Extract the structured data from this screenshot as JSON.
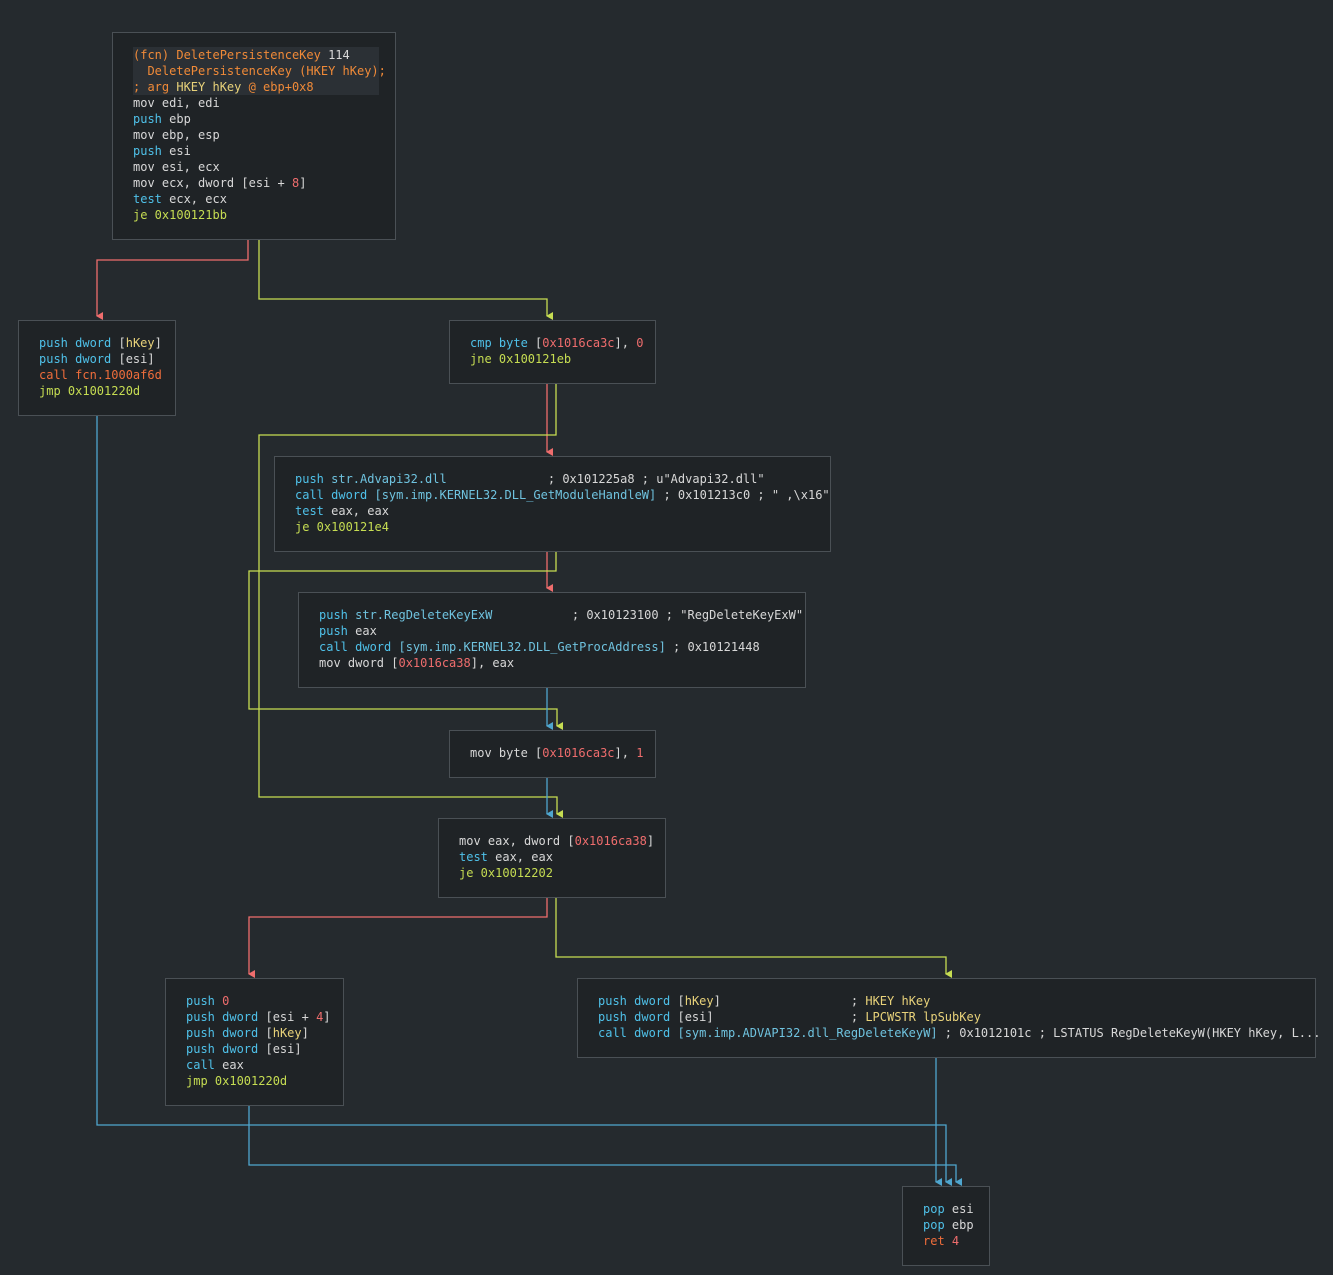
{
  "colors": {
    "background": "#252a2e",
    "node_bg": "#1f2326",
    "node_border": "#4a5055",
    "edge_true": "#c6dd52",
    "edge_false": "#ef6d6d",
    "edge_uncond": "#4fa6cf"
  },
  "nodes": {
    "n1": {
      "header": [
        [
          {
            "t": "(fcn) DeletePersistenceKey ",
            "c": "c-orange"
          },
          {
            "t": "114",
            "c": "c-plain"
          }
        ],
        [
          {
            "t": "  DeletePersistenceKey ",
            "c": "c-orange"
          },
          {
            "t": "(HKEY hKey);",
            "c": "c-orange"
          }
        ],
        [
          {
            "t": "; arg ",
            "c": "c-orange"
          },
          {
            "t": "HKEY hKey ",
            "c": "c-yellow"
          },
          {
            "t": "@ ebp+0x8",
            "c": "c-orange"
          }
        ]
      ],
      "lines": [
        [
          {
            "t": "mov ",
            "c": "c-plain"
          },
          {
            "t": "edi, edi",
            "c": "c-plain"
          }
        ],
        [
          {
            "t": "push ",
            "c": "op-blue"
          },
          {
            "t": "ebp",
            "c": "c-plain"
          }
        ],
        [
          {
            "t": "mov ",
            "c": "c-plain"
          },
          {
            "t": "ebp, esp",
            "c": "c-plain"
          }
        ],
        [
          {
            "t": "push ",
            "c": "op-blue"
          },
          {
            "t": "esi",
            "c": "c-plain"
          }
        ],
        [
          {
            "t": "mov ",
            "c": "c-plain"
          },
          {
            "t": "esi, ecx",
            "c": "c-plain"
          }
        ],
        [
          {
            "t": "mov ",
            "c": "c-plain"
          },
          {
            "t": "ecx, dword [esi + ",
            "c": "c-plain"
          },
          {
            "t": "8",
            "c": "c-red"
          },
          {
            "t": "]",
            "c": "c-plain"
          }
        ],
        [
          {
            "t": "test ",
            "c": "op-blue"
          },
          {
            "t": "ecx, ecx",
            "c": "c-plain"
          }
        ],
        [
          {
            "t": "je 0x100121bb",
            "c": "op-green"
          }
        ]
      ]
    },
    "n2": {
      "lines": [
        [
          {
            "t": "push dword ",
            "c": "op-blue"
          },
          {
            "t": "[",
            "c": "c-plain"
          },
          {
            "t": "hKey",
            "c": "c-yellow"
          },
          {
            "t": "]",
            "c": "c-plain"
          }
        ],
        [
          {
            "t": "push dword ",
            "c": "op-blue"
          },
          {
            "t": "[esi]",
            "c": "c-plain"
          }
        ],
        [
          {
            "t": "call fcn.1000af6d",
            "c": "op-red"
          }
        ],
        [
          {
            "t": "jmp 0x1001220d",
            "c": "op-green"
          }
        ]
      ]
    },
    "n3": {
      "lines": [
        [
          {
            "t": "cmp byte ",
            "c": "op-blue"
          },
          {
            "t": "[",
            "c": "c-plain"
          },
          {
            "t": "0x1016ca3c",
            "c": "c-red"
          },
          {
            "t": "], ",
            "c": "c-plain"
          },
          {
            "t": "0",
            "c": "c-red"
          }
        ],
        [
          {
            "t": "jne 0x100121eb",
            "c": "op-green"
          }
        ]
      ]
    },
    "n4": {
      "lines": [
        [
          {
            "t": "push ",
            "c": "op-blue"
          },
          {
            "t": "str.Advapi32.dll",
            "c": "c-cyan"
          },
          {
            "t": "              ; 0x101225a8 ; u\"Advapi32.dll\"",
            "c": "c-comment"
          }
        ],
        [
          {
            "t": "call dword ",
            "c": "op-blue"
          },
          {
            "t": "[sym.imp.KERNEL32.DLL_GetModuleHandleW]",
            "c": "c-cyan"
          },
          {
            "t": " ; 0x101213c0 ; \" ,\\x16\"",
            "c": "c-comment"
          }
        ],
        [
          {
            "t": "test ",
            "c": "op-blue"
          },
          {
            "t": "eax, eax",
            "c": "c-plain"
          }
        ],
        [
          {
            "t": "je 0x100121e4",
            "c": "op-green"
          }
        ]
      ]
    },
    "n5": {
      "lines": [
        [
          {
            "t": "push ",
            "c": "op-blue"
          },
          {
            "t": "str.RegDeleteKeyExW",
            "c": "c-cyan"
          },
          {
            "t": "           ; 0x10123100 ; \"RegDeleteKeyExW\"",
            "c": "c-comment"
          }
        ],
        [
          {
            "t": "push ",
            "c": "op-blue"
          },
          {
            "t": "eax",
            "c": "c-plain"
          }
        ],
        [
          {
            "t": "call dword ",
            "c": "op-blue"
          },
          {
            "t": "[sym.imp.KERNEL32.DLL_GetProcAddress]",
            "c": "c-cyan"
          },
          {
            "t": " ; 0x10121448",
            "c": "c-comment"
          }
        ],
        [
          {
            "t": "mov ",
            "c": "c-plain"
          },
          {
            "t": "dword [",
            "c": "c-plain"
          },
          {
            "t": "0x1016ca38",
            "c": "c-red"
          },
          {
            "t": "], eax",
            "c": "c-plain"
          }
        ]
      ]
    },
    "n6": {
      "lines": [
        [
          {
            "t": "mov ",
            "c": "c-plain"
          },
          {
            "t": "byte [",
            "c": "c-plain"
          },
          {
            "t": "0x1016ca3c",
            "c": "c-red"
          },
          {
            "t": "], ",
            "c": "c-plain"
          },
          {
            "t": "1",
            "c": "c-red"
          }
        ]
      ]
    },
    "n7": {
      "lines": [
        [
          {
            "t": "mov ",
            "c": "c-plain"
          },
          {
            "t": "eax, dword [",
            "c": "c-plain"
          },
          {
            "t": "0x1016ca38",
            "c": "c-red"
          },
          {
            "t": "]",
            "c": "c-plain"
          }
        ],
        [
          {
            "t": "test ",
            "c": "op-blue"
          },
          {
            "t": "eax, eax",
            "c": "c-plain"
          }
        ],
        [
          {
            "t": "je 0x10012202",
            "c": "op-green"
          }
        ]
      ]
    },
    "n8": {
      "lines": [
        [
          {
            "t": "push ",
            "c": "op-blue"
          },
          {
            "t": "0",
            "c": "c-red"
          }
        ],
        [
          {
            "t": "push dword ",
            "c": "op-blue"
          },
          {
            "t": "[esi + ",
            "c": "c-plain"
          },
          {
            "t": "4",
            "c": "c-red"
          },
          {
            "t": "]",
            "c": "c-plain"
          }
        ],
        [
          {
            "t": "push dword ",
            "c": "op-blue"
          },
          {
            "t": "[",
            "c": "c-plain"
          },
          {
            "t": "hKey",
            "c": "c-yellow"
          },
          {
            "t": "]",
            "c": "c-plain"
          }
        ],
        [
          {
            "t": "push dword ",
            "c": "op-blue"
          },
          {
            "t": "[esi]",
            "c": "c-plain"
          }
        ],
        [
          {
            "t": "call ",
            "c": "op-blue"
          },
          {
            "t": "eax",
            "c": "c-plain"
          }
        ],
        [
          {
            "t": "jmp 0x1001220d",
            "c": "op-green"
          }
        ]
      ]
    },
    "n9": {
      "lines": [
        [
          {
            "t": "push dword ",
            "c": "op-blue"
          },
          {
            "t": "[",
            "c": "c-plain"
          },
          {
            "t": "hKey",
            "c": "c-yellow"
          },
          {
            "t": "]",
            "c": "c-plain"
          },
          {
            "t": "                  ; ",
            "c": "c-comment"
          },
          {
            "t": "HKEY hKey",
            "c": "c-yellow"
          }
        ],
        [
          {
            "t": "push dword ",
            "c": "op-blue"
          },
          {
            "t": "[esi]",
            "c": "c-plain"
          },
          {
            "t": "                   ; ",
            "c": "c-comment"
          },
          {
            "t": "LPCWSTR lpSubKey",
            "c": "c-yellow"
          }
        ],
        [
          {
            "t": "call dword ",
            "c": "op-blue"
          },
          {
            "t": "[sym.imp.ADVAPI32.dll_RegDeleteKeyW]",
            "c": "c-cyan"
          },
          {
            "t": " ; 0x1012101c ; LSTATUS RegDeleteKeyW(HKEY hKey, L...",
            "c": "c-comment"
          }
        ]
      ]
    },
    "n10": {
      "lines": [
        [
          {
            "t": "pop ",
            "c": "op-blue"
          },
          {
            "t": "esi",
            "c": "c-plain"
          }
        ],
        [
          {
            "t": "pop ",
            "c": "op-blue"
          },
          {
            "t": "ebp",
            "c": "c-plain"
          }
        ],
        [
          {
            "t": "ret ",
            "c": "op-red"
          },
          {
            "t": "4",
            "c": "c-red"
          }
        ]
      ]
    }
  }
}
